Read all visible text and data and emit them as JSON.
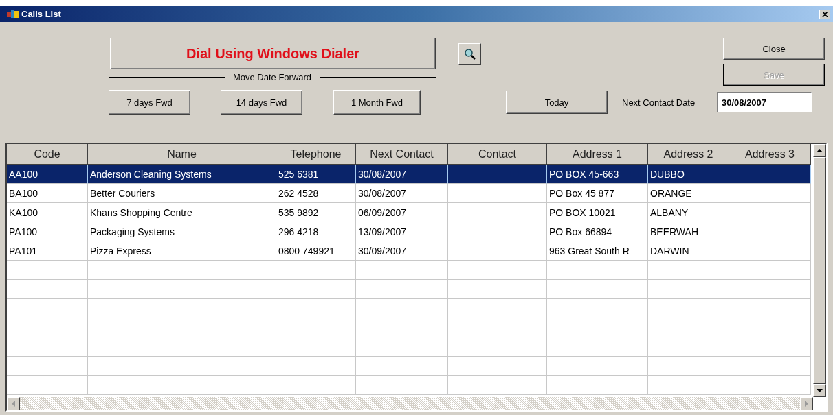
{
  "window": {
    "title": "Calls List"
  },
  "dial_button": {
    "label": "Dial Using Windows Dialer"
  },
  "close_button": {
    "label": "Close",
    "disabled": false
  },
  "save_button": {
    "label": "Save",
    "disabled": true
  },
  "move_date_label": "Move Date Forward",
  "forward_buttons": [
    "7 days Fwd",
    "14 days Fwd",
    "1 Month Fwd"
  ],
  "today_button": "Today",
  "next_contact_date": {
    "label": "Next Contact Date",
    "value": "30/08/2007"
  },
  "table": {
    "columns": [
      "Code",
      "Name",
      "Telephone",
      "Next Contact",
      "Contact",
      "Address 1",
      "Address 2",
      "Address 3"
    ],
    "rows": [
      {
        "selected": true,
        "cells": [
          "AA100",
          "Anderson Cleaning Systems",
          "525 6381",
          "30/08/2007",
          "",
          "PO BOX 45-663",
          "DUBBO",
          ""
        ]
      },
      {
        "selected": false,
        "cells": [
          "BA100",
          "Better Couriers",
          "262 4528",
          "30/08/2007",
          "",
          "PO Box 45 877",
          "ORANGE",
          ""
        ]
      },
      {
        "selected": false,
        "cells": [
          "KA100",
          "Khans Shopping Centre",
          "535 9892",
          "06/09/2007",
          "",
          "PO BOX 10021",
          "ALBANY",
          ""
        ]
      },
      {
        "selected": false,
        "cells": [
          "PA100",
          "Packaging Systems",
          "296 4218",
          "13/09/2007",
          "",
          "PO Box 66894",
          "BEERWAH",
          ""
        ]
      },
      {
        "selected": false,
        "cells": [
          "PA101",
          "Pizza Express",
          "0800 749921",
          "30/09/2007",
          "",
          "963 Great South R",
          "DARWIN",
          ""
        ]
      }
    ]
  }
}
